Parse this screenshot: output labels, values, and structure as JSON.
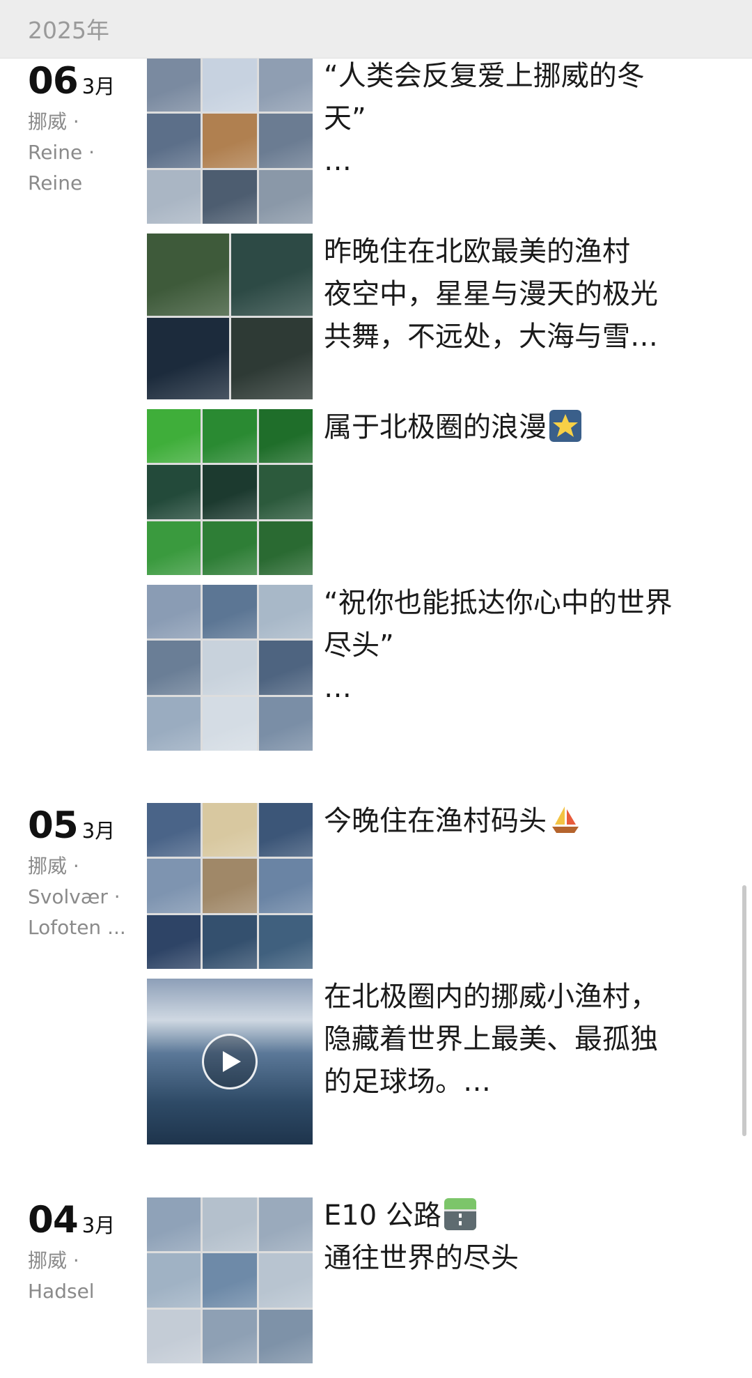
{
  "header": {
    "year": "2025年"
  },
  "groups": [
    {
      "day": "06",
      "month": "3月",
      "location": [
        "挪威 ·",
        "Reine ·",
        "Reine"
      ],
      "posts": [
        {
          "text": "“人类会反复爱上挪威的冬\n天”\n…",
          "layout": "grid9",
          "colors": [
            "#7a8aa0",
            "#c7d2e0",
            "#8f9eb2",
            "#5c6f89",
            "#b08050",
            "#6b7c92",
            "#aab6c4",
            "#4d5d70",
            "#8a98a8"
          ]
        },
        {
          "text": "昨晚住在北欧最美的渔村\n夜空中，星星与漫天的极光\n共舞，不远处，大海与雪…",
          "layout": "grid4",
          "colors": [
            "#3e5a3a",
            "#2d4a45",
            "#1c2b3c",
            "#2e3a35"
          ]
        },
        {
          "text": "属于北极圈的浪漫",
          "layout": "grid9",
          "emoji": "star-emoji",
          "colors": [
            "#3fae3a",
            "#2a8a32",
            "#1f6e2a",
            "#234a3a",
            "#1c3a2f",
            "#2c5a3c",
            "#3a9a3e",
            "#2e7e36",
            "#2a6a32"
          ]
        },
        {
          "text": "“祝你也能抵达你心中的世界\n尽头”\n…",
          "layout": "grid9",
          "colors": [
            "#8a9cb4",
            "#5c7694",
            "#a8b8c8",
            "#6a7e96",
            "#c8d2dc",
            "#4e6480",
            "#9aacc0",
            "#d4dce4",
            "#7a8ea6"
          ]
        }
      ]
    },
    {
      "day": "05",
      "month": "3月",
      "location": [
        "挪威 ·",
        "Svolvær ·",
        "Lofoten ..."
      ],
      "posts": [
        {
          "text": "今晚住在渔村码头",
          "layout": "grid9",
          "emoji": "sailboat-emoji",
          "colors": [
            "#4a6488",
            "#d8c8a0",
            "#3c5678",
            "#7e94b0",
            "#a08868",
            "#6a84a4",
            "#2e4466",
            "#34506e",
            "#40607e"
          ]
        },
        {
          "text": "在北极圈内的挪威小渔村，\n隐藏着世界上最美、最孤独\n的足球场。…",
          "layout": "video",
          "colors": [
            "#4e6a88"
          ]
        }
      ]
    },
    {
      "day": "04",
      "month": "3月",
      "location": [
        "挪威 ·",
        "Hadsel"
      ],
      "posts": [
        {
          "text": "E10 公路\n通往世界的尽头",
          "layout": "grid9",
          "emoji": "road-emoji",
          "colors": [
            "#8fa2b8",
            "#b4c0cc",
            "#9aaabc",
            "#a0b2c4",
            "#6e8aa8",
            "#b8c4d0",
            "#c4ccd6",
            "#8ea0b4",
            "#7e92a8"
          ]
        }
      ]
    }
  ]
}
